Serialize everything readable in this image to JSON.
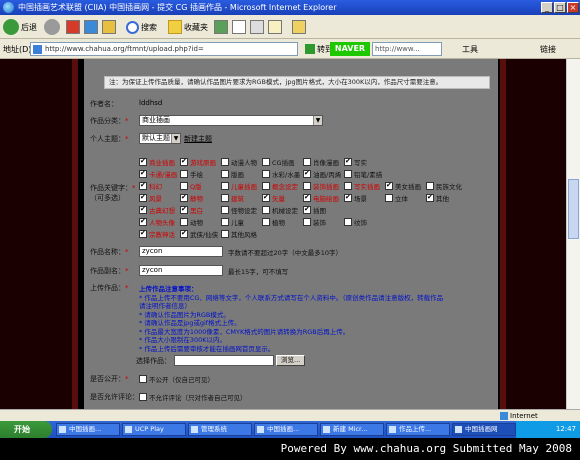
{
  "window": {
    "title": "中国插画艺术联盟 (CIIA) 中国插画网 - 提交 CG 插画作品 - Microsoft Internet Explorer"
  },
  "toolbar": {
    "back_label": "后退",
    "search_label": "搜索",
    "favorites_label": "收藏夹"
  },
  "address_bar": {
    "label": "地址(D)",
    "url": "http://www.chahua.org/ftmnt/upload.php?id=",
    "go_label": "转到",
    "links_label": "链接",
    "naver_label": "NAVER",
    "naver_placeholder": "http://www...",
    "tools_label": "工具"
  },
  "form": {
    "notice": "注：为保证上传作品质量，请确认作品图片要求为RGB模式，jpg图片格式，大小在300K以内，作品尺寸需要注意。",
    "author_label": "作者名：",
    "author_value": "lddhsd",
    "category_label": "作品分类：",
    "category_value": "商业插画",
    "personal_label": "个人主题：",
    "personal_value": "默认主题",
    "personal_link": "新建主题",
    "tags_label": "作品关键字：",
    "tags_sublabel": "（可多选）",
    "title_label": "作品名称：",
    "title_value": "zycon",
    "title_hint": "字数请不要超过20字（中文最多10字）",
    "subtitle_label": "作品副名：",
    "subtitle_value": "zycon",
    "subtitle_hint": "最长15字，可不填写",
    "upload_label": "上传作品：",
    "upload_notes": [
      "上传作品注意事项：",
      "* 作品上传不要用CG、网络等文字，个人联系方式请写在个人资料中。（原创类作品请注意版权，转载作品",
      "  请注明作者信息）",
      "* 请确认作品图片为RGB模式。",
      "* 请确认作品是jpg或gif格式上传。",
      "* 作品最大宽度为1000像素，CMYK格式的图片请转换为RGB后再上传。",
      "* 作品大小限制在300K以内。",
      "* 作品上传后需要审核才能在插画网首页显示。"
    ],
    "file_label": "选择作品：",
    "browse_label": "浏览...",
    "public_label": "是否公开：",
    "public_option": "不公开（仅自己可见）",
    "comment_label": "是否允许评论：",
    "comment_option": "不允许评论（只对作者自己可见）"
  },
  "tag_rows": [
    [
      {
        "t": "商业插画",
        "on": true,
        "red": true
      },
      {
        "t": "游戏原画",
        "on": true,
        "red": true
      },
      {
        "t": "动漫人物",
        "on": false,
        "red": false
      },
      {
        "t": "CG插画",
        "on": false,
        "red": false
      },
      {
        "t": "肖像漫画",
        "on": false,
        "red": false
      },
      {
        "t": "写实",
        "on": true,
        "red": false
      }
    ],
    [
      {
        "t": "卡通/漫画",
        "on": true,
        "red": true
      },
      {
        "t": "手绘",
        "on": false,
        "red": false
      },
      {
        "t": "版画",
        "on": false,
        "red": false
      },
      {
        "t": "水彩/水墨",
        "on": false,
        "red": false
      },
      {
        "t": "油画/丙烯",
        "on": true,
        "red": false
      },
      {
        "t": "铅笔/素描",
        "on": false,
        "red": false
      }
    ],
    [
      {
        "t": "科幻",
        "on": true,
        "red": true
      },
      {
        "t": "Q版",
        "on": false,
        "red": true
      },
      {
        "t": "儿童插画",
        "on": false,
        "red": true
      },
      {
        "t": "概念设定",
        "on": false,
        "red": true
      },
      {
        "t": "装饰插画",
        "on": false,
        "red": true
      },
      {
        "t": "写实插画",
        "on": false,
        "red": true
      },
      {
        "t": "美女插画",
        "on": true,
        "red": false
      },
      {
        "t": "民族文化",
        "on": false,
        "red": false
      }
    ],
    [
      {
        "t": "风景",
        "on": true,
        "red": true
      },
      {
        "t": "静物",
        "on": true,
        "red": true
      },
      {
        "t": "建筑",
        "on": false,
        "red": true
      },
      {
        "t": "矢量",
        "on": true,
        "red": true
      },
      {
        "t": "电脑绘画",
        "on": true,
        "red": true
      },
      {
        "t": "场景",
        "on": true,
        "red": false
      },
      {
        "t": "立体",
        "on": false,
        "red": false
      },
      {
        "t": "其他",
        "on": true,
        "red": false
      }
    ],
    [
      {
        "t": "古典幻想",
        "on": true,
        "red": true
      },
      {
        "t": "黑白",
        "on": true,
        "red": true
      },
      {
        "t": "怪物设定",
        "on": false,
        "red": false
      },
      {
        "t": "机械设定",
        "on": false,
        "red": false
      },
      {
        "t": "插图",
        "on": true,
        "red": false
      }
    ],
    [
      {
        "t": "人物头像",
        "on": true,
        "red": true
      },
      {
        "t": "动物",
        "on": false,
        "red": false
      },
      {
        "t": "儿童",
        "on": false,
        "red": false
      },
      {
        "t": "植物",
        "on": false,
        "red": false
      },
      {
        "t": "装饰",
        "on": false,
        "red": false
      },
      {
        "t": "纹饰",
        "on": false,
        "red": false
      }
    ],
    [
      {
        "t": "宗教神话",
        "on": true,
        "red": true
      },
      {
        "t": "武侠/仙侠",
        "on": true,
        "red": false
      },
      {
        "t": "其他风格",
        "on": false,
        "red": false
      }
    ]
  ],
  "status": {
    "left": "",
    "zone": "Internet"
  },
  "taskbar": {
    "start_label": "开始",
    "tasks": [
      "中国插画...",
      "UCP Play",
      "管理系统",
      "中国插画...",
      "新建 Micr...",
      "作品上传...",
      "中国插画网"
    ],
    "clock": "12:47"
  },
  "footer": {
    "text": "Powered By www.chahua.org  Submitted May 2008"
  }
}
